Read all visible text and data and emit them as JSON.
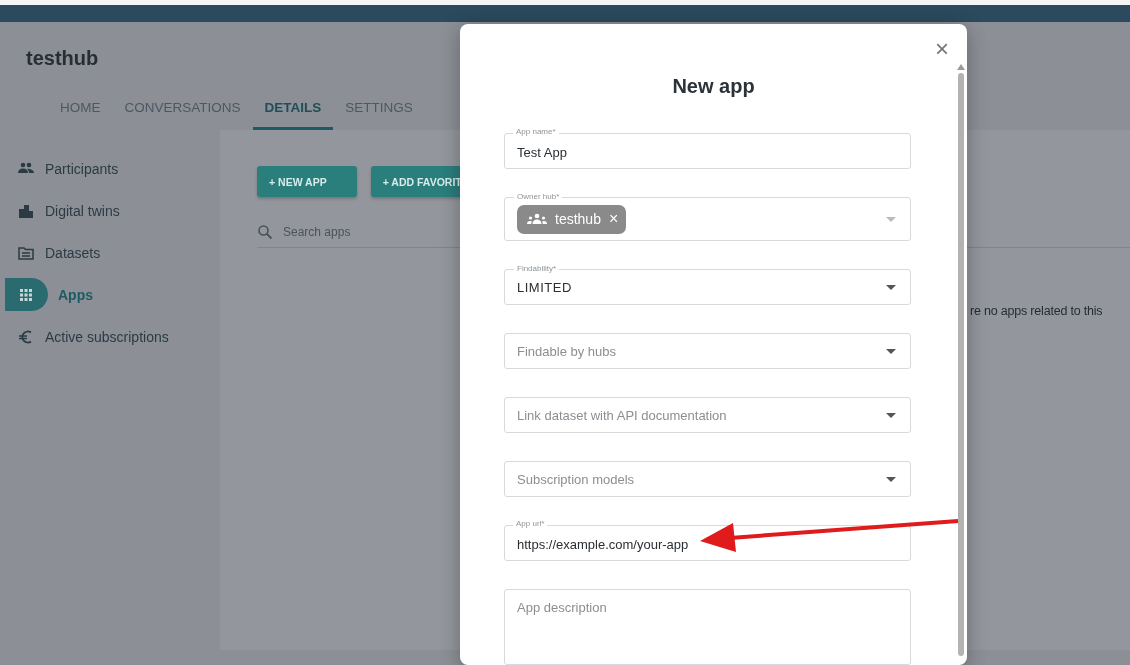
{
  "hub_title": "testhub",
  "tabs": [
    {
      "label": "HOME",
      "selected": false
    },
    {
      "label": "CONVERSATIONS",
      "selected": false
    },
    {
      "label": "DETAILS",
      "selected": true
    },
    {
      "label": "SETTINGS",
      "selected": false
    }
  ],
  "sidebar": {
    "items": [
      {
        "label": "Participants",
        "selected": false
      },
      {
        "label": "Digital twins",
        "selected": false
      },
      {
        "label": "Datasets",
        "selected": false
      },
      {
        "label": "Apps",
        "selected": true
      },
      {
        "label": "Active subscriptions",
        "selected": false
      }
    ]
  },
  "actions": [
    "+ NEW APP",
    "+ ADD FAVORIT"
  ],
  "search": {
    "placeholder": "Search apps"
  },
  "empty_message": "re no apps related to this",
  "dialog": {
    "title": "New app",
    "close": "×",
    "fields": [
      {
        "kind": "text",
        "label": "App name*",
        "value": "Test App"
      },
      {
        "kind": "chips",
        "label": "Owner hub*",
        "chips": [
          {
            "label": "testhub",
            "remove": "×"
          }
        ]
      },
      {
        "kind": "select",
        "label": "Findability*",
        "value": "LIMITED"
      },
      {
        "kind": "select",
        "placeholder": "Findable by hubs"
      },
      {
        "kind": "select",
        "placeholder": "Link dataset with API documentation"
      },
      {
        "kind": "select",
        "placeholder": "Subscription models"
      },
      {
        "kind": "text",
        "label": "App url*",
        "value": "https://example.com/your-app"
      },
      {
        "kind": "textarea",
        "placeholder": "App description"
      }
    ]
  }
}
